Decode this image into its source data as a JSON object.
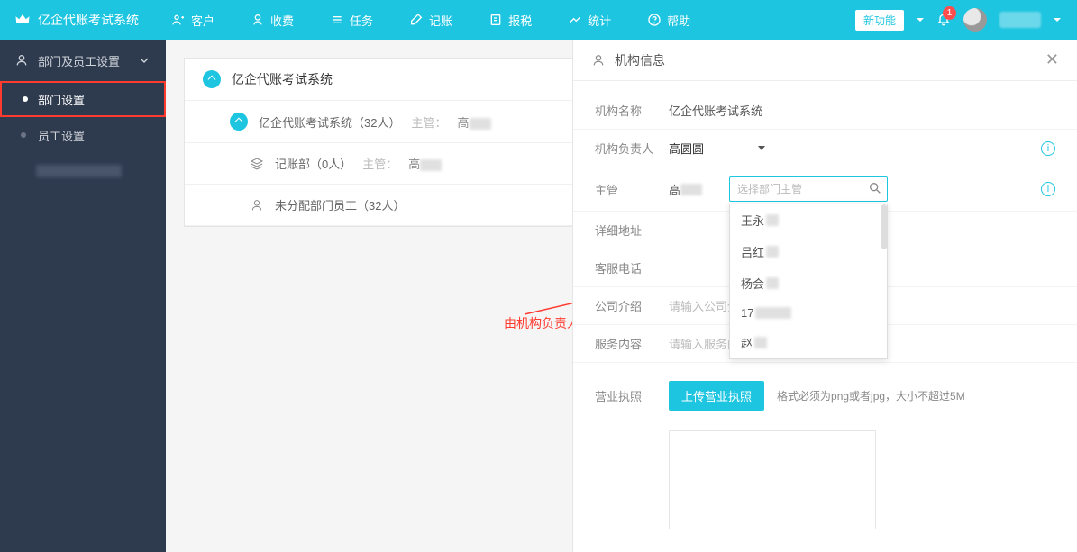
{
  "topbar": {
    "brand": "亿企代账考试系统",
    "nav": [
      {
        "label": "客户"
      },
      {
        "label": "收费"
      },
      {
        "label": "任务"
      },
      {
        "label": "记账"
      },
      {
        "label": "报税"
      },
      {
        "label": "统计"
      },
      {
        "label": "帮助"
      }
    ],
    "new_feature": "新功能",
    "notif_count": "1"
  },
  "sidebar": {
    "header": "部门及员工设置",
    "items": [
      {
        "label": "部门设置",
        "active": true,
        "highlighted": true
      },
      {
        "label": "员工设置",
        "active": false,
        "highlighted": false
      }
    ]
  },
  "dept": {
    "root": "亿企代账考试系统",
    "lvl1_name": "亿企代账考试系统（32人）",
    "lvl1_sup_label": "主管：",
    "lvl1_sup_name": "高",
    "lvl2_name": "记账部（0人）",
    "lvl2_sup_label": "主管：",
    "lvl2_sup_name": "高",
    "unassigned": "未分配部门员工（32人）"
  },
  "annotation": "由机构负责人将其设置为公司级主管",
  "panel": {
    "title": "机构信息",
    "org_name_label": "机构名称",
    "org_name_value": "亿企代账考试系统",
    "owner_label": "机构负责人",
    "owner_value": "高圆圆",
    "manager_label": "主管",
    "manager_value": "高",
    "manager_select_placeholder": "选择部门主管",
    "manager_options": [
      "王永",
      "吕红",
      "杨会",
      "17",
      "赵"
    ],
    "address_label": "详细地址",
    "phone_label": "客服电话",
    "intro_label": "公司介绍",
    "intro_placeholder": "请输入公司介",
    "service_label": "服务内容",
    "service_placeholder": "请输入服务内容",
    "license_label": "营业执照",
    "upload_btn": "上传营业执照",
    "upload_hint": "格式必须为png或者jpg，大小不超过5M"
  }
}
